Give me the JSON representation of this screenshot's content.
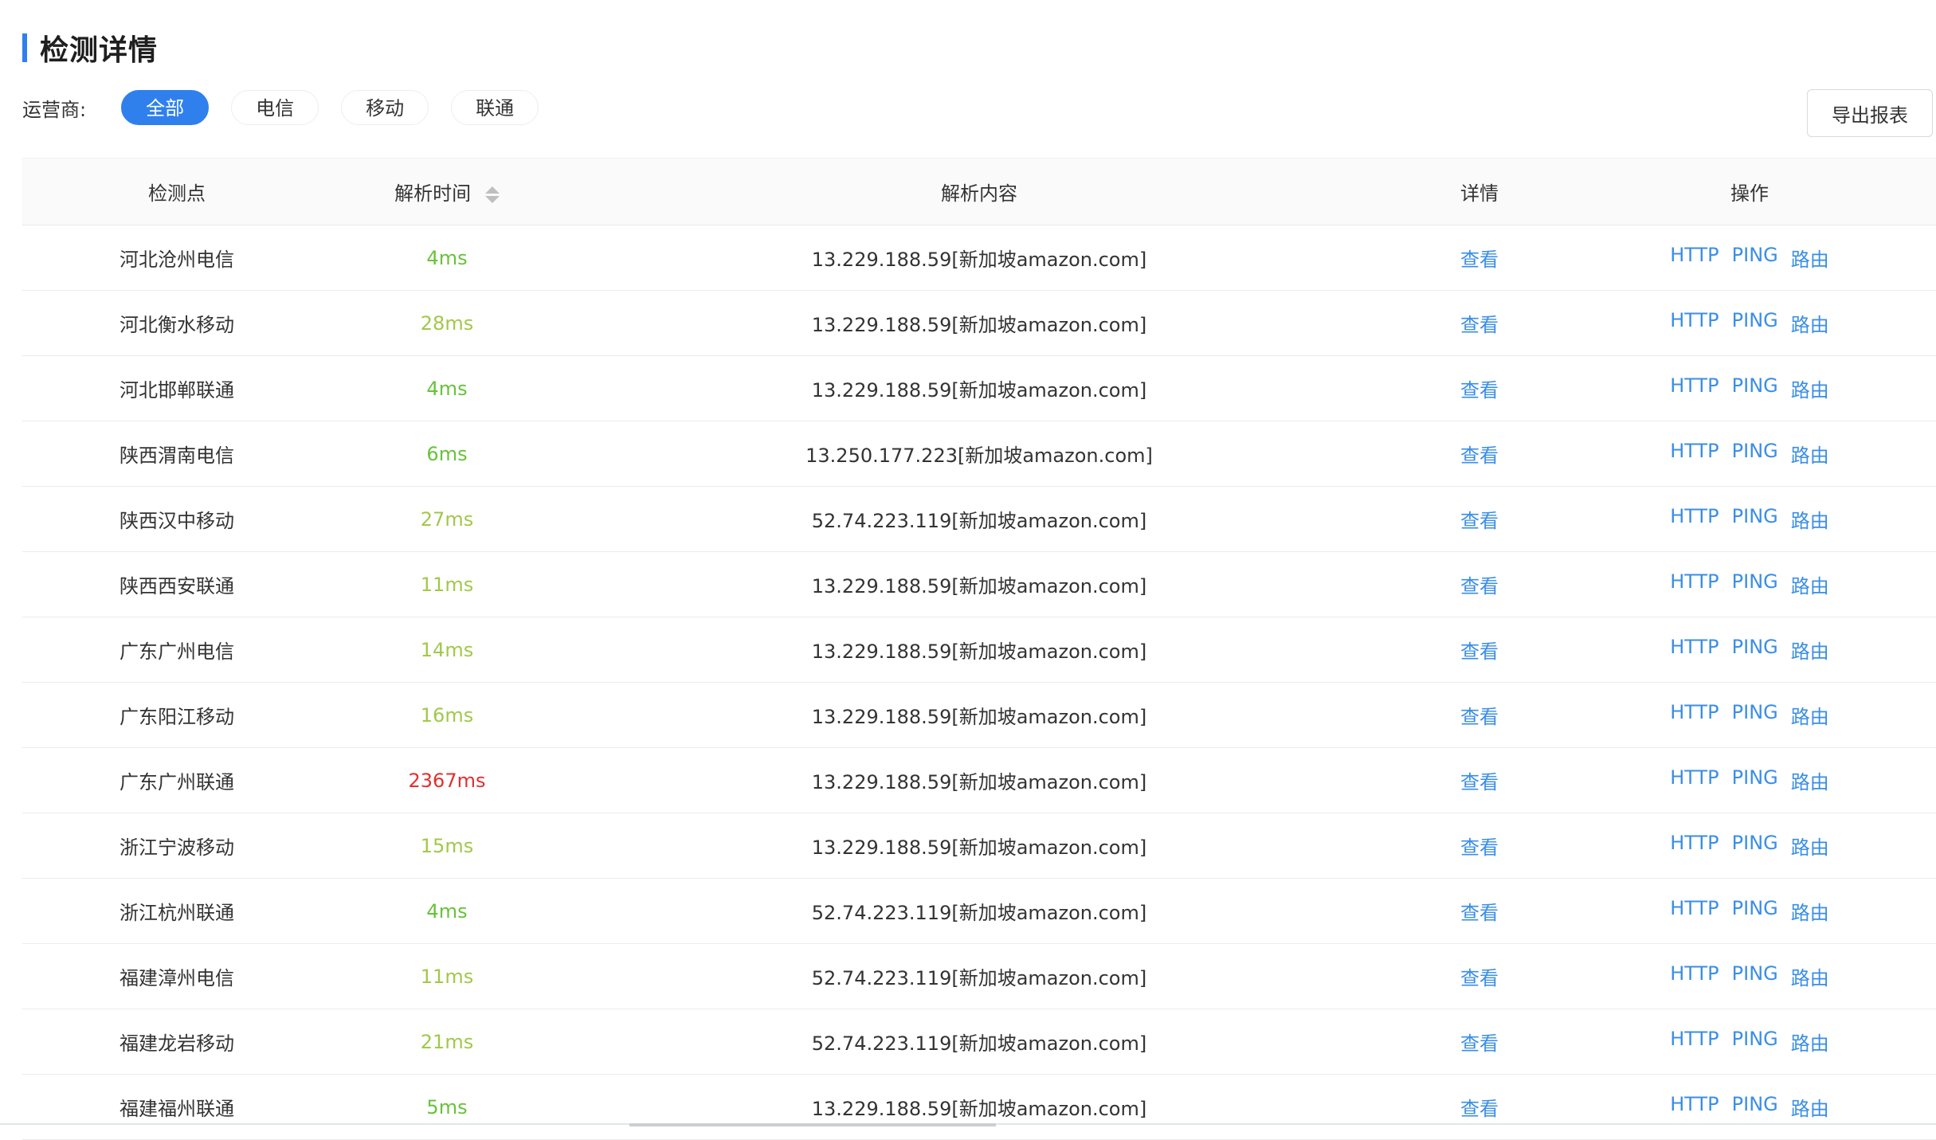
{
  "page": {
    "title": "检测详情"
  },
  "filter": {
    "label": "运营商:",
    "options": [
      "全部",
      "电信",
      "移动",
      "联通"
    ],
    "active": "全部"
  },
  "export_label": "导出报表",
  "table": {
    "headers": [
      "检测点",
      "解析时间",
      "解析内容",
      "详情",
      "操作"
    ],
    "detail_label": "查看",
    "op_labels": [
      "HTTP",
      "PING",
      "路由"
    ],
    "rows": [
      {
        "point": "河北沧州电信",
        "time": "4ms",
        "content": "13.229.188.59[新加坡amazon.com]",
        "tone": "green"
      },
      {
        "point": "河北衡水移动",
        "time": "28ms",
        "content": "13.229.188.59[新加坡amazon.com]",
        "tone": "olive"
      },
      {
        "point": "河北邯郸联通",
        "time": "4ms",
        "content": "13.229.188.59[新加坡amazon.com]",
        "tone": "green"
      },
      {
        "point": "陕西渭南电信",
        "time": "6ms",
        "content": "13.250.177.223[新加坡amazon.com]",
        "tone": "green"
      },
      {
        "point": "陕西汉中移动",
        "time": "27ms",
        "content": "52.74.223.119[新加坡amazon.com]",
        "tone": "olive"
      },
      {
        "point": "陕西西安联通",
        "time": "11ms",
        "content": "13.229.188.59[新加坡amazon.com]",
        "tone": "olive"
      },
      {
        "point": "广东广州电信",
        "time": "14ms",
        "content": "13.229.188.59[新加坡amazon.com]",
        "tone": "olive"
      },
      {
        "point": "广东阳江移动",
        "time": "16ms",
        "content": "13.229.188.59[新加坡amazon.com]",
        "tone": "olive"
      },
      {
        "point": "广东广州联通",
        "time": "2367ms",
        "content": "13.229.188.59[新加坡amazon.com]",
        "tone": "red"
      },
      {
        "point": "浙江宁波移动",
        "time": "15ms",
        "content": "13.229.188.59[新加坡amazon.com]",
        "tone": "olive"
      },
      {
        "point": "浙江杭州联通",
        "time": "4ms",
        "content": "52.74.223.119[新加坡amazon.com]",
        "tone": "green"
      },
      {
        "point": "福建漳州电信",
        "time": "11ms",
        "content": "52.74.223.119[新加坡amazon.com]",
        "tone": "olive"
      },
      {
        "point": "福建龙岩移动",
        "time": "21ms",
        "content": "52.74.223.119[新加坡amazon.com]",
        "tone": "olive"
      },
      {
        "point": "福建福州联通",
        "time": "5ms",
        "content": "13.229.188.59[新加坡amazon.com]",
        "tone": "green"
      }
    ]
  },
  "colors": {
    "accent": "#2f80ed",
    "link": "#3a8ee6",
    "time_green": "#67c23a",
    "time_olive": "#a2c84a",
    "time_red": "#e03131"
  }
}
